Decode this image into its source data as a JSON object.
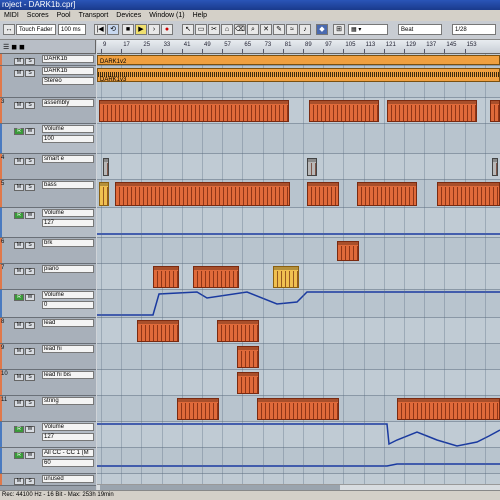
{
  "window": {
    "title": "roject - DARK1b.cpr]"
  },
  "menu": [
    "MIDI",
    "Scores",
    "Pool",
    "Transport",
    "Devices",
    "Window (1)",
    "Help"
  ],
  "toolbar": {
    "mode": "Touch Fader",
    "latency": "100 ms",
    "snap": "Beat",
    "quantize": "1/28"
  },
  "ruler": {
    "ticks": [
      "9",
      "17",
      "25",
      "33",
      "41",
      "49",
      "57",
      "65",
      "73",
      "81",
      "89",
      "97",
      "105",
      "113",
      "121",
      "129",
      "137",
      "145",
      "153"
    ]
  },
  "tracks": [
    {
      "num": "",
      "name": "DARK1b",
      "value": "",
      "kind": "folder"
    },
    {
      "num": "",
      "name": "DARK1b",
      "value": "Stereo",
      "kind": "audio"
    },
    {
      "num": "3",
      "name": "assembly",
      "value": "",
      "kind": "midi"
    },
    {
      "num": "",
      "name": "Volume",
      "value": "100",
      "kind": "auto"
    },
    {
      "num": "4",
      "name": "smart e",
      "value": "",
      "kind": "midi"
    },
    {
      "num": "5",
      "name": "bass",
      "value": "",
      "kind": "midi"
    },
    {
      "num": "",
      "name": "Volume",
      "value": "127",
      "kind": "auto"
    },
    {
      "num": "6",
      "name": "brk",
      "value": "",
      "kind": "midi"
    },
    {
      "num": "7",
      "name": "piano",
      "value": "",
      "kind": "midi"
    },
    {
      "num": "",
      "name": "Volume",
      "value": "0",
      "kind": "auto"
    },
    {
      "num": "8",
      "name": "lead",
      "value": "",
      "kind": "midi"
    },
    {
      "num": "9",
      "name": "lead hi",
      "value": "",
      "kind": "midi"
    },
    {
      "num": "10",
      "name": "lead hi bis",
      "value": "",
      "kind": "midi"
    },
    {
      "num": "11",
      "name": "string",
      "value": "",
      "kind": "midi"
    },
    {
      "num": "",
      "name": "Volume",
      "value": "127",
      "kind": "auto"
    },
    {
      "num": "",
      "name": "All CC - CC 1 (M",
      "value": "60",
      "kind": "auto"
    },
    {
      "num": "",
      "name": "unused",
      "value": "",
      "kind": "midi"
    }
  ],
  "parts": {
    "dark_labels": [
      "DARK1v2",
      "DARK1v3"
    ]
  },
  "status": {
    "text": "Rec: 44100 Hz - 16 Bit - Max: 253h 19min"
  },
  "colors": {
    "part": "#e06a3a",
    "accent_part": "#f0c050",
    "automation": "#1a3aa0",
    "arrange_bg": "#c0cbd4"
  }
}
